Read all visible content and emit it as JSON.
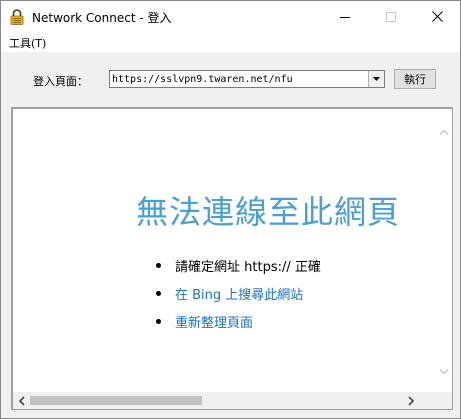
{
  "window": {
    "title": "Network Connect - 登入"
  },
  "menubar": {
    "items": [
      {
        "label": "工具(T)"
      }
    ]
  },
  "address": {
    "label": "登入頁面：",
    "value": "https://sslvpn9.twaren.net/nfu",
    "go_label": "執行"
  },
  "page": {
    "error_title": "無法連線至此網頁",
    "bullets": [
      {
        "text": "請確定網址 https:// 正確",
        "is_link": false
      },
      {
        "text": "在 Bing 上搜尋此網站",
        "is_link": true
      },
      {
        "text": "重新整理頁面",
        "is_link": true
      }
    ]
  },
  "colors": {
    "title_blue": "#4a9fd6",
    "link_blue": "#1a73c8",
    "icon_yellow": "#f5b800"
  },
  "icons": {
    "app": "padlock-icon",
    "minimize": "minimize-icon",
    "maximize": "maximize-icon",
    "close": "close-icon"
  }
}
